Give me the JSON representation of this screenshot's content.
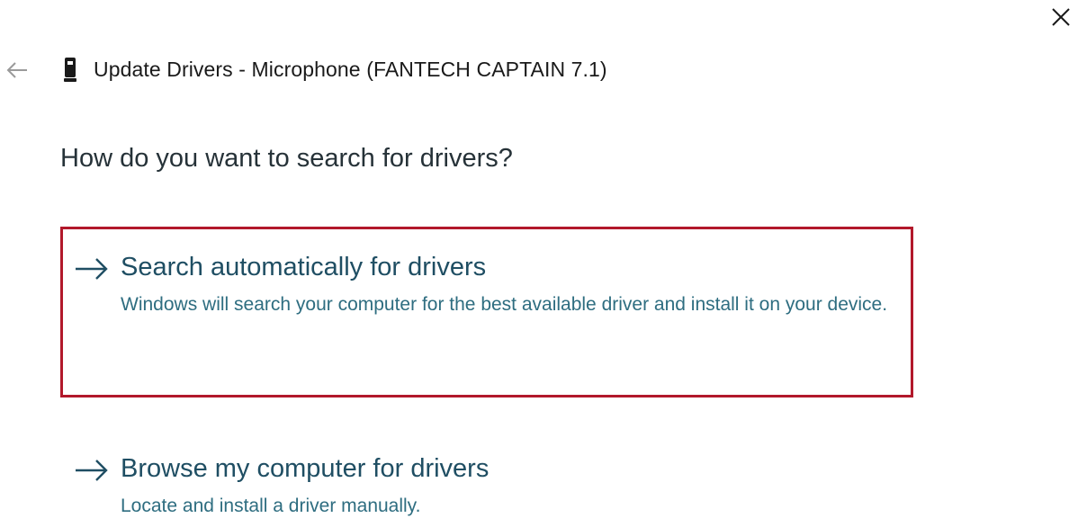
{
  "window": {
    "title": "Update Drivers - Microphone (FANTECH CAPTAIN 7.1)",
    "close_icon": "close-icon",
    "back_icon": "back-arrow-icon",
    "device_icon": "microphone-device-icon"
  },
  "main": {
    "question": "How do you want to search for drivers?",
    "options": [
      {
        "title": "Search automatically for drivers",
        "description": "Windows will search your computer for the best available driver and install it on your device.",
        "icon": "arrow-right-icon",
        "highlighted": true
      },
      {
        "title": "Browse my computer for drivers",
        "description": "Locate and install a driver manually.",
        "icon": "arrow-right-icon",
        "highlighted": false
      }
    ]
  },
  "colors": {
    "highlight_border": "#b2182b",
    "option_title": "#1f4e63",
    "option_desc": "#2e6d80",
    "arrow": "#1f4e63"
  }
}
